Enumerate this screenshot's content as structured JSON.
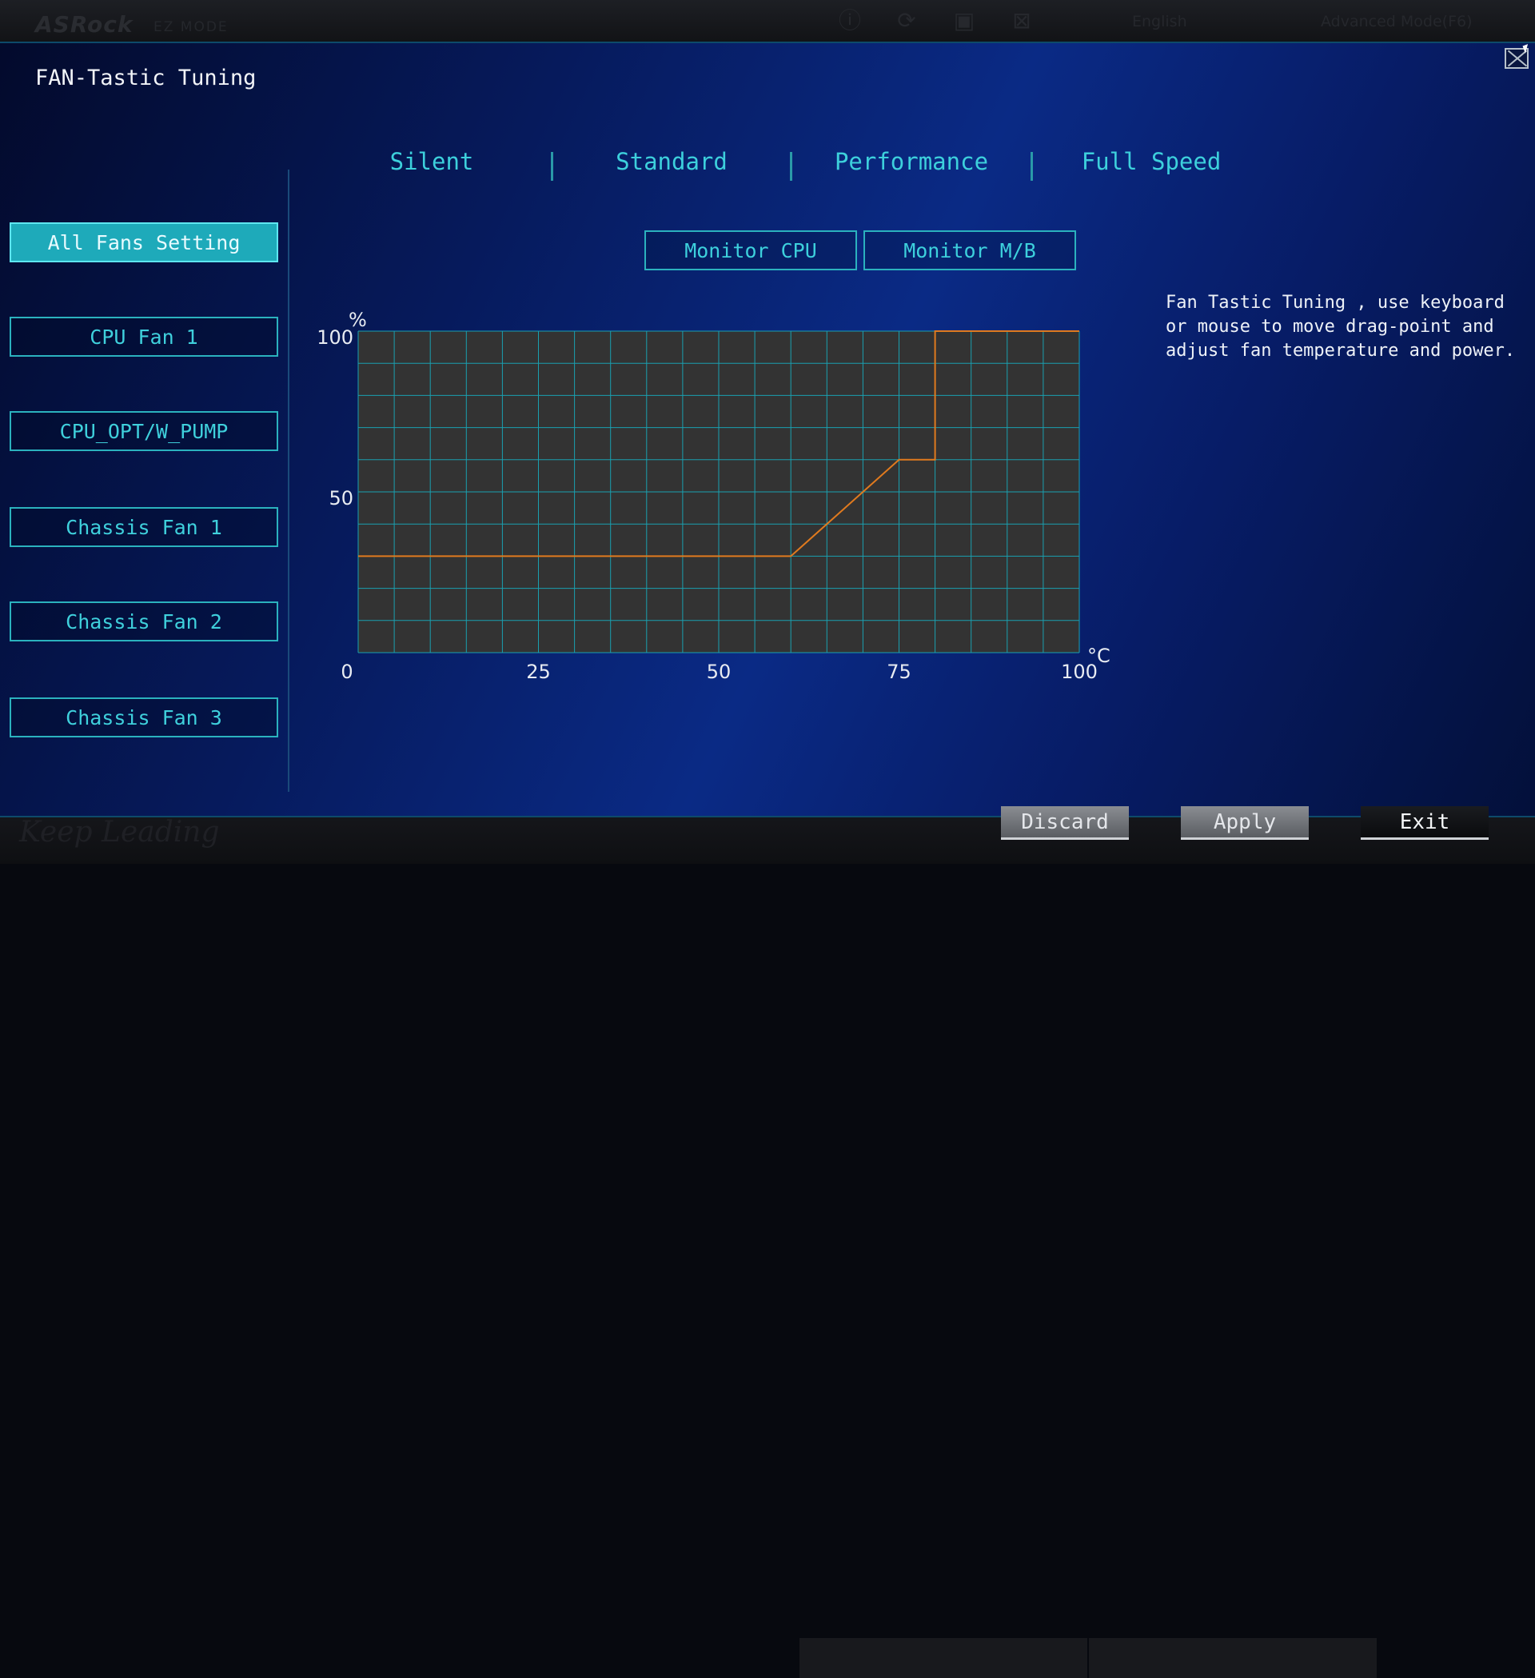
{
  "background": {
    "brand": "ASRock",
    "mode": "EZ MODE",
    "language": "English",
    "advanced_mode": "Advanced Mode(F6)",
    "slogan": "Keep Leading"
  },
  "dialog": {
    "title": "FAN-Tastic Tuning"
  },
  "sidebar": {
    "items": [
      {
        "label": "All Fans Setting",
        "active": true
      },
      {
        "label": "CPU Fan 1",
        "active": false
      },
      {
        "label": "CPU_OPT/W_PUMP",
        "active": false
      },
      {
        "label": "Chassis Fan 1",
        "active": false
      },
      {
        "label": "Chassis Fan 2",
        "active": false
      },
      {
        "label": "Chassis Fan 3",
        "active": false
      }
    ]
  },
  "presets": {
    "silent": "Silent",
    "standard": "Standard",
    "performance": "Performance",
    "full_speed": "Full Speed"
  },
  "monitor": {
    "cpu": "Monitor CPU",
    "mb": "Monitor M/B"
  },
  "help": {
    "text": "Fan Tastic Tuning , use keyboard\nor mouse to move drag-point and\nadjust fan temperature and power."
  },
  "actions": {
    "discard": "Discard",
    "apply": "Apply",
    "exit": "Exit"
  },
  "colors": {
    "accent": "#3dd0dc",
    "curve": "#e07a1e",
    "grid": "#1aa0b0",
    "plot_bg": "#333333"
  },
  "chart_data": {
    "type": "line",
    "xlabel": "°C",
    "ylabel": "%",
    "xlim": [
      0,
      100
    ],
    "ylim": [
      0,
      100
    ],
    "x_ticks": [
      0,
      25,
      50,
      75,
      100
    ],
    "y_ticks": [
      0,
      50,
      100
    ],
    "grid": true,
    "series": [
      {
        "x": [
          0,
          60,
          75,
          80,
          80,
          100
        ],
        "y": [
          30,
          30,
          60,
          60,
          100,
          100
        ]
      }
    ]
  }
}
